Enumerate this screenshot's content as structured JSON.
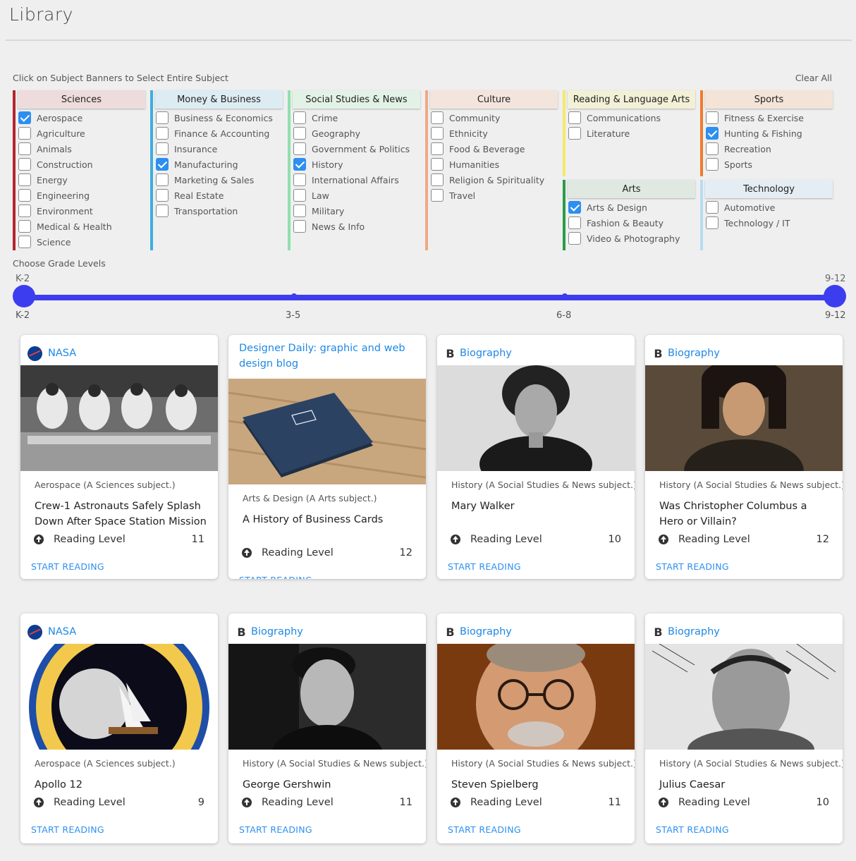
{
  "page": {
    "title": "Library"
  },
  "filters": {
    "instruction": "Click on Subject Banners to Select Entire Subject",
    "clear_all": "Clear All"
  },
  "subjects": [
    {
      "name": "Sciences",
      "band_color": "#b3262e",
      "banner_bg": "#eedcdc",
      "items": [
        {
          "label": "Aerospace",
          "checked": true
        },
        {
          "label": "Agriculture",
          "checked": false
        },
        {
          "label": "Animals",
          "checked": false
        },
        {
          "label": "Construction",
          "checked": false
        },
        {
          "label": "Energy",
          "checked": false
        },
        {
          "label": "Engineering",
          "checked": false
        },
        {
          "label": "Environment",
          "checked": false
        },
        {
          "label": "Medical & Health",
          "checked": false
        },
        {
          "label": "Science",
          "checked": false
        }
      ]
    },
    {
      "name": "Money & Business",
      "band_color": "#3eaee0",
      "banner_bg": "#dcecf2",
      "items": [
        {
          "label": "Business & Economics",
          "checked": false
        },
        {
          "label": "Finance & Accounting",
          "checked": false
        },
        {
          "label": "Insurance",
          "checked": false
        },
        {
          "label": "Manufacturing",
          "checked": true
        },
        {
          "label": "Marketing & Sales",
          "checked": false
        },
        {
          "label": "Real Estate",
          "checked": false
        },
        {
          "label": "Transportation",
          "checked": false
        }
      ]
    },
    {
      "name": "Social Studies & News",
      "band_color": "#90dfae",
      "banner_bg": "#e2f2e6",
      "items": [
        {
          "label": "Crime",
          "checked": false
        },
        {
          "label": "Geography",
          "checked": false
        },
        {
          "label": "Government & Politics",
          "checked": false
        },
        {
          "label": "History",
          "checked": true
        },
        {
          "label": "International Affairs",
          "checked": false
        },
        {
          "label": "Law",
          "checked": false
        },
        {
          "label": "Military",
          "checked": false
        },
        {
          "label": "News & Info",
          "checked": false
        }
      ]
    },
    {
      "name": "Culture",
      "band_color": "#f0a884",
      "banner_bg": "#f4e5dc",
      "items": [
        {
          "label": "Community",
          "checked": false
        },
        {
          "label": "Ethnicity",
          "checked": false
        },
        {
          "label": "Food & Beverage",
          "checked": false
        },
        {
          "label": "Humanities",
          "checked": false
        },
        {
          "label": "Religion & Spirituality",
          "checked": false
        },
        {
          "label": "Travel",
          "checked": false
        }
      ]
    },
    {
      "name": "Reading & Language Arts",
      "band_color": "#f2ea6a",
      "banner_bg": "#f2f0d6",
      "items": [
        {
          "label": "Communications",
          "checked": false
        },
        {
          "label": "Literature",
          "checked": false
        }
      ]
    },
    {
      "name": "Sports",
      "band_color": "#f07a30",
      "banner_bg": "#f4e4d8",
      "items": [
        {
          "label": "Fitness & Exercise",
          "checked": false
        },
        {
          "label": "Hunting & Fishing",
          "checked": true
        },
        {
          "label": "Recreation",
          "checked": false
        },
        {
          "label": "Sports",
          "checked": false
        }
      ]
    },
    {
      "name": "Arts",
      "band_color": "#2a9c4a",
      "banner_bg": "#dfe9e1",
      "items": [
        {
          "label": "Arts & Design",
          "checked": true
        },
        {
          "label": "Fashion & Beauty",
          "checked": false
        },
        {
          "label": "Video & Photography",
          "checked": false
        }
      ]
    },
    {
      "name": "Technology",
      "band_color": "#b6dcf2",
      "banner_bg": "#e4edf3",
      "items": [
        {
          "label": "Automotive",
          "checked": false
        },
        {
          "label": "Technology / IT",
          "checked": false
        }
      ]
    }
  ],
  "grade": {
    "label": "Choose Grade Levels",
    "min_value": "K-2",
    "max_value": "9-12",
    "ticks": [
      "K-2",
      "3-5",
      "6-8",
      "9-12"
    ],
    "accent": "#3d3df0"
  },
  "cards": [
    {
      "source": "NASA",
      "icon": "nasa-logo-icon",
      "image": "astronauts-photo",
      "subject": "Aerospace (A Sciences subject.)",
      "title": "Crew-1 Astronauts Safely Splash Down After Space Station Mission",
      "reading_label": "Reading Level",
      "reading_level": "11",
      "action": "START READING"
    },
    {
      "source": "Designer Daily: graphic and web design blog",
      "icon": "",
      "image": "business-cards-photo",
      "subject": "Arts & Design (A Arts subject.)",
      "title": "A History of Business Cards",
      "reading_label": "Reading Level",
      "reading_level": "12",
      "action": "START READING"
    },
    {
      "source": "Biography",
      "icon": "biography-b-icon",
      "image": "mary-walker-portrait",
      "subject": "History (A Social Studies & News subject.)",
      "title": "Mary Walker",
      "reading_label": "Reading Level",
      "reading_level": "10",
      "action": "START READING"
    },
    {
      "source": "Biography",
      "icon": "biography-b-icon",
      "image": "columbus-portrait",
      "subject": "History (A Social Studies & News subject.)",
      "title": "Was Christopher Columbus a Hero or Villain?",
      "reading_label": "Reading Level",
      "reading_level": "12",
      "action": "START READING"
    },
    {
      "source": "NASA",
      "icon": "nasa-logo-icon",
      "image": "apollo-12-patch",
      "subject": "Aerospace (A Sciences subject.)",
      "title": "Apollo 12",
      "reading_label": "Reading Level",
      "reading_level": "9",
      "action": "START READING"
    },
    {
      "source": "Biography",
      "icon": "biography-b-icon",
      "image": "george-gershwin-portrait",
      "subject": "History (A Social Studies & News subject.)",
      "title": "George Gershwin",
      "reading_label": "Reading Level",
      "reading_level": "11",
      "action": "START READING"
    },
    {
      "source": "Biography",
      "icon": "biography-b-icon",
      "image": "steven-spielberg-portrait",
      "subject": "History (A Social Studies & News subject.)",
      "title": "Steven Spielberg",
      "reading_label": "Reading Level",
      "reading_level": "11",
      "action": "START READING"
    },
    {
      "source": "Biography",
      "icon": "biography-b-icon",
      "image": "julius-caesar-portrait",
      "subject": "History (A Social Studies & News subject.)",
      "title": "Julius Caesar",
      "reading_label": "Reading Level",
      "reading_level": "10",
      "action": "START READING"
    }
  ]
}
